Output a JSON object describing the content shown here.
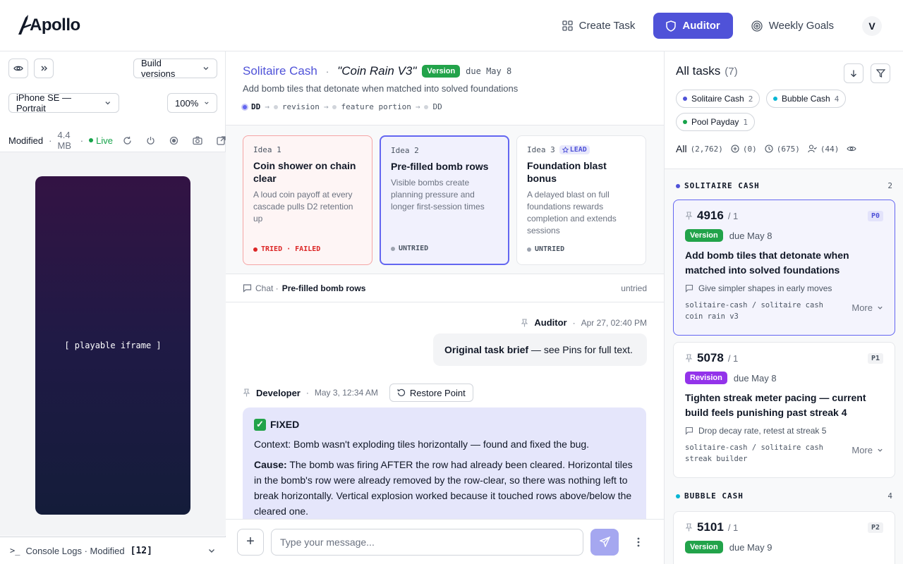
{
  "app": {
    "logo": "Apollo",
    "nav": [
      {
        "label": "Create Task"
      },
      {
        "label": "Auditor"
      },
      {
        "label": "Weekly Goals"
      }
    ],
    "avatar": "V",
    "accent": "#4f52d8"
  },
  "left": {
    "build_versions": "Build versions",
    "device": "iPhone SE — Portrait",
    "zoom": "100%",
    "status": "Modified",
    "size": "4.4 MB",
    "live": "Live",
    "iframe_label": "[ playable iframe ]",
    "console": "Console Logs · Modified",
    "console_count": "[12]"
  },
  "task": {
    "game": "Solitaire Cash",
    "separator": "·",
    "version_title": "\"Coin Rain V3\"",
    "badge": "Version",
    "due": "due May 8",
    "subtitle": "Add bomb tiles that detonate when matched into solved foundations",
    "flow": [
      "DD",
      "revision",
      "feature portion",
      "DD"
    ]
  },
  "ideas": [
    {
      "num": "Idea 1",
      "title": "Coin shower on chain clear",
      "desc": "A loud coin payoff at every cascade pulls D2 retention up",
      "status": "TRIED · FAILED"
    },
    {
      "num": "Idea 2",
      "title": "Pre-filled bomb rows",
      "desc": "Visible bombs create planning pressure and longer first-session times",
      "status": "UNTRIED"
    },
    {
      "num": "Idea 3",
      "lead": "LEAD",
      "title": "Foundation blast bonus",
      "desc": "A delayed blast on full foundations rewards completion and extends sessions",
      "status": "UNTRIED"
    }
  ],
  "chat": {
    "label": "Chat ·",
    "name": "Pre-filled bomb rows",
    "state": "untried",
    "messages": {
      "auditor_author": "Auditor",
      "auditor_time": "Apr 27, 02:40 PM",
      "auditor_bold": "Original task brief",
      "auditor_text": " — see Pins for full text.",
      "dev_author": "Developer",
      "dev_time": "May 3, 12:34 AM",
      "restore": "Restore Point",
      "fixed": "FIXED",
      "context": "Context: Bomb wasn't exploding tiles horizontally — found and fixed the bug.",
      "cause_label": "Cause:",
      "cause_text": " The bomb was firing AFTER the row had already been cleared. Horizontal tiles in the bomb's row were already removed by the row-clear, so there was nothing left to break horizontally. Vertical explosion worked because it touched rows above/below the cleared one."
    },
    "placeholder": "Type your message..."
  },
  "tasks": {
    "title": "All tasks",
    "count": "(7)",
    "chips": [
      {
        "name": "Solitaire Cash",
        "count": "2",
        "color": "#4f52d8"
      },
      {
        "name": "Bubble Cash",
        "count": "4",
        "color": "#06b6d4"
      },
      {
        "name": "Pool Payday",
        "count": "1",
        "color": "#16a34a"
      }
    ],
    "filters": {
      "all": "All",
      "all_count": "(2,762)",
      "new_count": "(0)",
      "pending_count": "(675)",
      "assigned_count": "(44)"
    },
    "groups": [
      {
        "name": "SOLITAIRE CASH",
        "count": "2"
      },
      {
        "name": "BUBBLE CASH",
        "count": "4"
      }
    ],
    "cards": [
      {
        "id": "4916",
        "sub": "/ 1",
        "prio": "P0",
        "type": "Version",
        "due": "due May 8",
        "title": "Add bomb tiles that detonate when matched into solved foundations",
        "note": "Give simpler shapes in early moves",
        "path": "solitaire-cash / solitaire cash coin rain v3",
        "more": "More"
      },
      {
        "id": "5078",
        "sub": "/ 1",
        "prio": "P1",
        "type": "Revision",
        "due": "due May 8",
        "title": "Tighten streak meter pacing — current build feels punishing past streak 4",
        "note": "Drop decay rate, retest at streak 5",
        "path": "solitaire-cash / solitaire cash streak builder",
        "more": "More"
      },
      {
        "id": "5101",
        "sub": "/ 1",
        "prio": "P2",
        "type": "Version",
        "due": "due May 9"
      }
    ]
  }
}
